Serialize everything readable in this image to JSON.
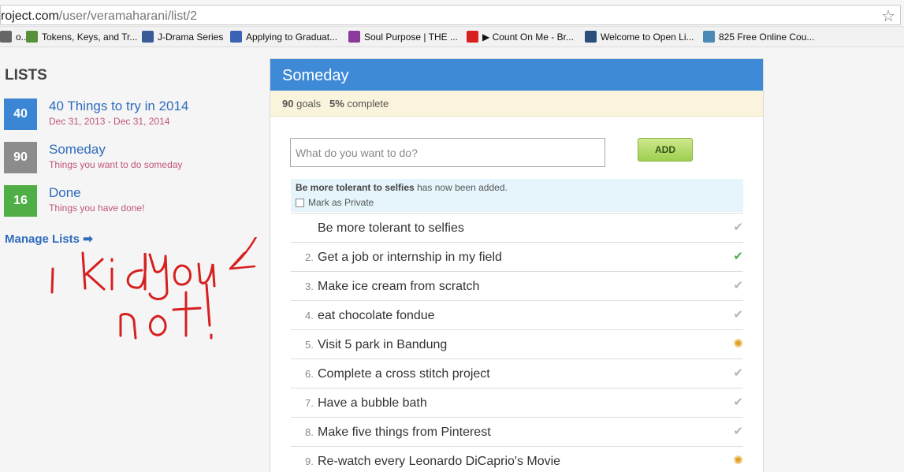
{
  "browser": {
    "url_host": "roject.com",
    "url_path": "/user/veramaharani/list/2"
  },
  "bookmarks": [
    {
      "label": "o...",
      "icon": "page-icon",
      "color": "#666666"
    },
    {
      "label": "Tokens, Keys, and Tr...",
      "icon": "tree-icon",
      "color": "#5a8f3c"
    },
    {
      "label": "J-Drama Series",
      "icon": "dx-icon",
      "color": "#3a5a9a"
    },
    {
      "label": "Applying to Graduat...",
      "icon": "globe-icon",
      "color": "#3a63b5"
    },
    {
      "label": "Soul Purpose | THE ...",
      "icon": "image-icon",
      "color": "#8a3a9a"
    },
    {
      "label": "▶ Count On Me - Br...",
      "icon": "youtube-icon",
      "color": "#d92020"
    },
    {
      "label": "Welcome to Open Li...",
      "icon": "open-icon",
      "color": "#2a4f7a"
    },
    {
      "label": "825 Free Online Cou...",
      "icon": "course-icon",
      "color": "#4a8ab5"
    }
  ],
  "sidebar": {
    "heading": "LISTS",
    "lists": [
      {
        "count": "40",
        "title": "40 Things to try in 2014",
        "subtitle": "Dec 31, 2013 - Dec 31, 2014",
        "color": "#3b86d4"
      },
      {
        "count": "90",
        "title": "Someday",
        "subtitle": "Things you want to do someday",
        "color": "#8c8c8c"
      },
      {
        "count": "16",
        "title": "Done",
        "subtitle": "Things you have done!",
        "color": "#4fae46"
      }
    ],
    "manage_label": "Manage Lists ➡"
  },
  "panel": {
    "title": "Someday",
    "goals_count": "90",
    "goals_label": "goals",
    "percent": "5%",
    "percent_label": "complete",
    "input_placeholder": "What do you want to do?",
    "add_label": "ADD",
    "notice_bold": "Be more tolerant to selfies",
    "notice_rest": "has now been added.",
    "mark_private": "Mark as Private"
  },
  "goals": [
    {
      "num": "",
      "text": "Be more tolerant to selfies",
      "status": "unchecked"
    },
    {
      "num": "2.",
      "text": "Get a job or internship in my field",
      "status": "done"
    },
    {
      "num": "3.",
      "text": "Make ice cream from scratch",
      "status": "unchecked"
    },
    {
      "num": "4.",
      "text": "eat chocolate fondue",
      "status": "unchecked"
    },
    {
      "num": "5.",
      "text": "Visit 5 park in Bandung",
      "status": "in-progress"
    },
    {
      "num": "6.",
      "text": "Complete a cross stitch project",
      "status": "unchecked"
    },
    {
      "num": "7.",
      "text": "Have a bubble bath",
      "status": "unchecked"
    },
    {
      "num": "8.",
      "text": "Make five things from Pinterest",
      "status": "unchecked"
    },
    {
      "num": "9.",
      "text": "Re-watch every Leonardo DiCaprio's Movie",
      "status": "in-progress"
    }
  ],
  "colors": {
    "done": "#4fae46",
    "unchecked": "#b5b5b5",
    "in-progress": "#e0a020"
  }
}
